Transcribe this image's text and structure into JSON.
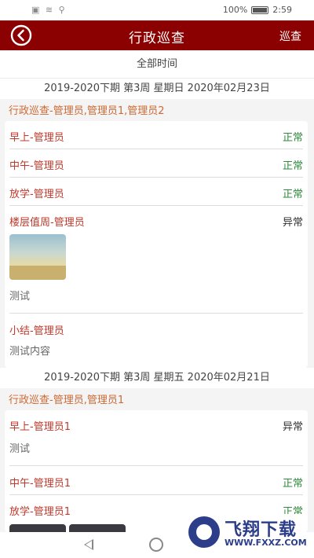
{
  "status_bar": {
    "left_icons": "▣ ≋ ⚲",
    "battery_percent": "100%",
    "time": "2:59"
  },
  "app_bar": {
    "title": "行政巡查",
    "action_label": "巡查"
  },
  "filter": {
    "label": "全部时间"
  },
  "sections": [
    {
      "date": "2019-2020下期 第3周 星期日 2020年02月23日",
      "group": "行政巡查-管理员,管理员1,管理员2",
      "rows": [
        {
          "label": "早上-管理员",
          "status": "正常"
        },
        {
          "label": "中午-管理员",
          "status": "正常"
        },
        {
          "label": "放学-管理员",
          "status": "正常"
        },
        {
          "label": "楼层值周-管理员",
          "status": "异常",
          "note": "测试"
        },
        {
          "label": "小结-管理员",
          "note": "测试内容"
        }
      ]
    },
    {
      "date": "2019-2020下期 第3周 星期五 2020年02月21日",
      "group": "行政巡查-管理员,管理员1",
      "rows": [
        {
          "label": "早上-管理员1",
          "status": "异常",
          "note": "测试"
        },
        {
          "label": "中午-管理员1",
          "status": "正常"
        },
        {
          "label": "放学-管理员1",
          "status": "正常"
        }
      ]
    }
  ],
  "watermark": {
    "title": "飞翔下载",
    "url": "WWW.FXXZ.COM"
  },
  "colors": {
    "brand": "#8b0000",
    "label_red": "#c0392b",
    "group_orange": "#cc6a35",
    "status_ok": "#2e8b3a"
  }
}
